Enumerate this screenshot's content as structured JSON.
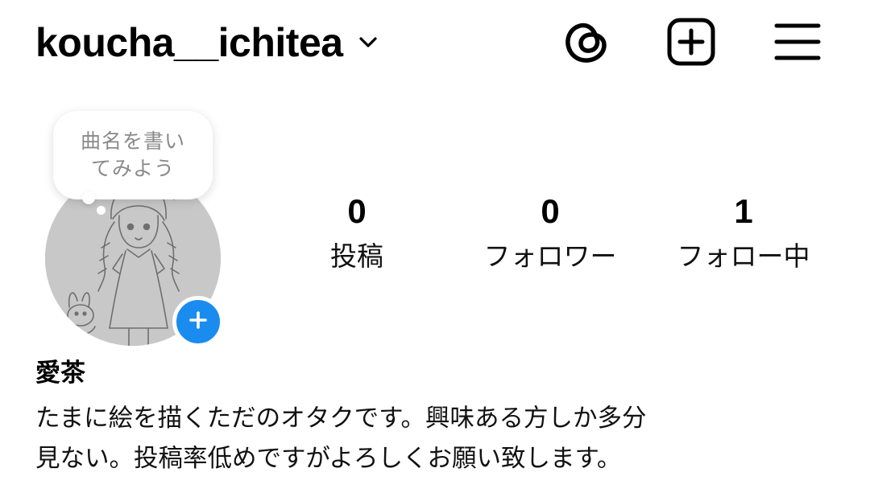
{
  "header": {
    "username": "koucha__ichitea",
    "icons": {
      "dropdown": "chevron-down-icon",
      "threads": "threads-icon",
      "create": "plus-square-icon",
      "menu": "hamburger-menu-icon"
    }
  },
  "note": {
    "lines": [
      "曲名を書い",
      "てみよう"
    ]
  },
  "avatar": {
    "add_icon": "plus-icon",
    "accent_color": "#1a8cf0"
  },
  "stats": {
    "posts": {
      "count": "0",
      "label": "投稿"
    },
    "followers": {
      "count": "0",
      "label": "フォロワー"
    },
    "following": {
      "count": "1",
      "label": "フォロー中"
    }
  },
  "profile": {
    "display_name": "愛茶",
    "bio_lines": [
      "たまに絵を描くただのオタクです。興味ある方しか多分",
      "見ない。投稿率低めですがよろしくお願い致します。"
    ]
  }
}
